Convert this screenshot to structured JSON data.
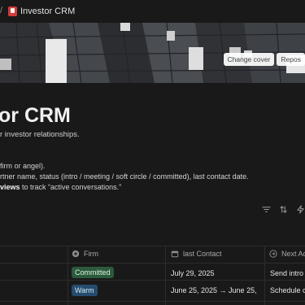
{
  "breadcrumb": {
    "separator": "/",
    "page_title": "Investor CRM"
  },
  "cover": {
    "change_cover": "Change cover",
    "reposition": "Repos"
  },
  "page": {
    "title": "or CRM",
    "description": "r investor relationships.",
    "bullets": {
      "b1": "firm or angel).",
      "b2": "rtner name, status (intro / meeting / soft circle / committed), last contact date.",
      "b3_bold": "views",
      "b3_rest": " to track “active conversations.”"
    }
  },
  "toolbar": {
    "icons": [
      "filter-icon",
      "sort-icon",
      "lightning-icon"
    ]
  },
  "table": {
    "columns": [
      {
        "label": "Firm",
        "icon": "plus-circle-icon"
      },
      {
        "label": "last Contact",
        "icon": "calendar-icon"
      },
      {
        "label": "Next Ac",
        "icon": "arrow-circle-icon"
      }
    ],
    "rows": [
      {
        "firm": "Committed",
        "firm_color": "#2c5a3c",
        "contact": "July 29, 2025",
        "next": "Send intro d"
      },
      {
        "firm": "Warm",
        "firm_color": "#254c6e",
        "contact": "June 25, 2025 → June 25,",
        "next": "Schedule c"
      }
    ]
  },
  "colors": {
    "background": "#191919",
    "tag_green": "#2c5a3c",
    "tag_blue": "#254c6e"
  }
}
